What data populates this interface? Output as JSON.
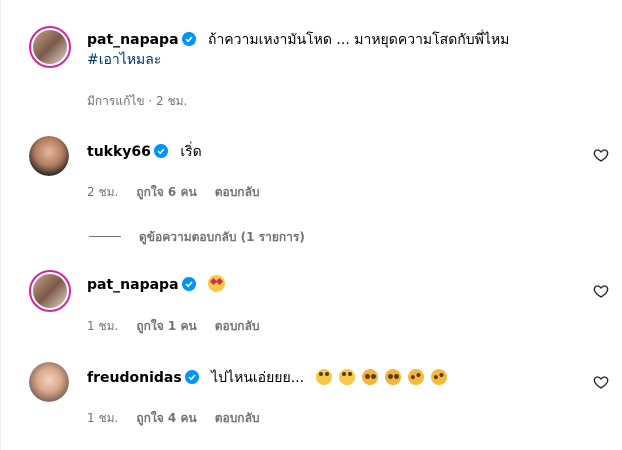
{
  "post": {
    "username": "pat_napapa",
    "caption": "ถ้าความเหงามันโหด ... มาหยุดความโสดกับพี่ไหม",
    "hashtag": "#เอาไหมละ",
    "meta": "มีการแก้ไข · 2 ชม."
  },
  "comments": [
    {
      "username": "tukky66",
      "text": "เริ่ด",
      "time": "2 ชม.",
      "likes": "ถูกใจ 6 คน",
      "reply": "ตอบกลับ"
    },
    {
      "username": "pat_napapa",
      "text": "",
      "time": "1 ชม.",
      "likes": "ถูกใจ 1 คน",
      "reply": "ตอบกลับ"
    },
    {
      "username": "freudonidas",
      "text": "ไปไหนเอ่ยยย...",
      "time": "1 ชม.",
      "likes": "ถูกใจ 4 คน",
      "reply": "ตอบกลับ"
    }
  ],
  "view_replies": "ดูข้อความตอบกลับ (1 รายการ)",
  "icons": [
    "verified-badge-icon",
    "heart-icon"
  ],
  "colors": {
    "verified": "#0095f6",
    "meta": "#737373",
    "story_ring": "#d6249f"
  }
}
